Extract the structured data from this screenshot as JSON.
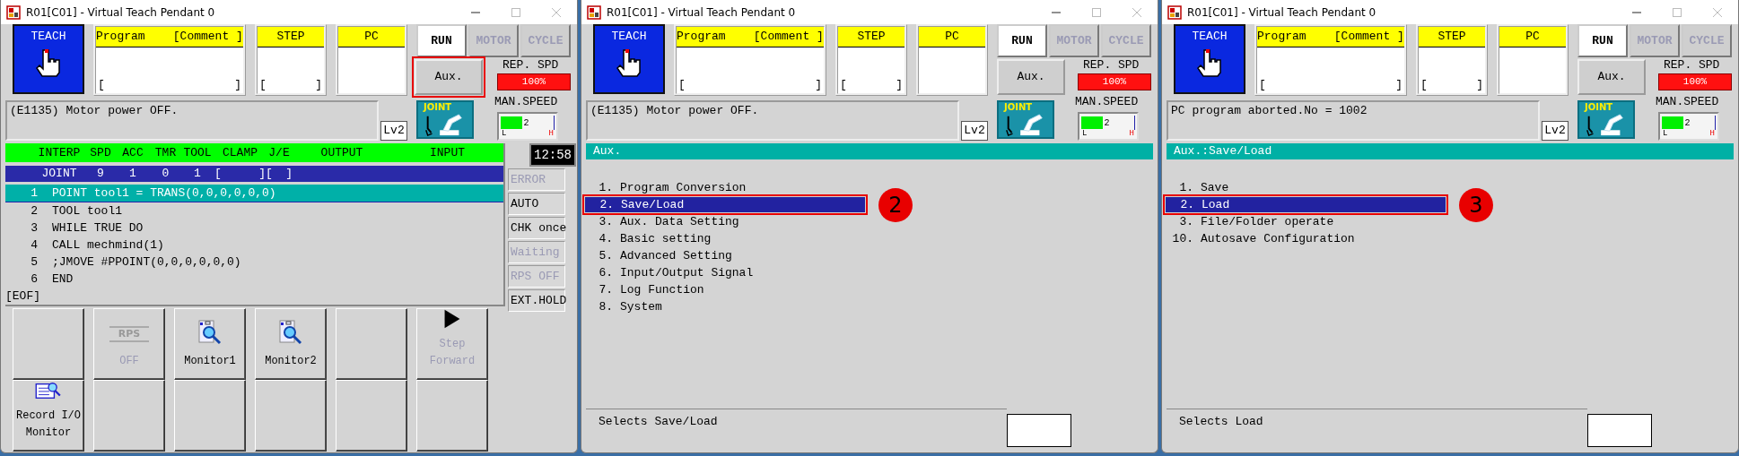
{
  "windows": [
    {
      "title": "R01[C01] - Virtual Teach Pendant 0",
      "mode": "TEACH",
      "program_box": {
        "label": "Program    [Comment ]",
        "bracket_open": "[",
        "bracket_close": "]"
      },
      "step_box": {
        "label": "STEP",
        "bracket_open": "[",
        "bracket_close": "]"
      },
      "pc_box": {
        "label": "PC"
      },
      "mode_buttons": [
        {
          "label": "RUN",
          "disabled": false
        },
        {
          "label": "MOTOR",
          "disabled": true
        },
        {
          "label": "CYCLE",
          "disabled": true
        }
      ],
      "aux_button": {
        "label": "Aux.",
        "highlighted": true
      },
      "rep_speed": {
        "label": "REP. SPD",
        "reading": "100%"
      },
      "man_speed": {
        "label": "MAN.SPEED",
        "level": 0.4,
        "reading": "2",
        "low": "L",
        "high": "H"
      },
      "message": "(E1135) Motor power OFF.",
      "access_level": "Lv2",
      "coordinate_mode": "JOINT",
      "screen": {
        "kind": "program",
        "clock": "12:58",
        "columns": [
          "INTERP",
          "SPD",
          "ACC",
          "TMR",
          "TOOL",
          "CLAMP",
          "J/E",
          "OUTPUT",
          "INPUT"
        ],
        "values": [
          "JOINT",
          "9",
          "1",
          "0",
          "1"
        ],
        "output": {
          "open": "[",
          "close": "]"
        },
        "input": {
          "open": "[",
          "close": "]"
        },
        "lines": [
          {
            "number": "1",
            "text": "POINT tool1 = TRANS(0,0,0,0,0,0)",
            "selected": true
          },
          {
            "number": "2",
            "text": "TOOL tool1",
            "selected": false
          },
          {
            "number": "3",
            "text": "WHILE TRUE DO",
            "selected": false
          },
          {
            "number": "4",
            "text": "CALL mechmind(1)",
            "selected": false
          },
          {
            "number": "5",
            "text": ";JMOVE #PPOINT(0,0,0,0,0,0)",
            "selected": false
          },
          {
            "number": "6",
            "text": "END",
            "selected": false
          }
        ],
        "eof": "[EOF]",
        "indicators": [
          {
            "label": "ERROR",
            "active": false
          },
          {
            "label": "AUTO",
            "active": true
          },
          {
            "label": "CHK once",
            "active": true
          },
          {
            "label": "Waiting",
            "active": false
          },
          {
            "label": "RPS OFF",
            "active": false
          },
          {
            "label": "EXT.HOLD",
            "active": true
          }
        ],
        "function_keys": [
          {
            "kind": "blank"
          },
          {
            "kind": "rps",
            "icon_label": "RPS",
            "label": "OFF",
            "disabled": true
          },
          {
            "kind": "monitor",
            "label": "Monitor1",
            "disabled": false
          },
          {
            "kind": "monitor",
            "label": "Monitor2",
            "disabled": false
          },
          {
            "kind": "blank"
          },
          {
            "kind": "step",
            "label": "Step Forward",
            "disabled": true
          },
          {
            "kind": "record",
            "label": "Record I/O Monitor",
            "disabled": false
          },
          {
            "kind": "blank"
          },
          {
            "kind": "blank"
          },
          {
            "kind": "blank"
          },
          {
            "kind": "blank"
          },
          {
            "kind": "blank"
          }
        ]
      }
    },
    {
      "title": "R01[C01] - Virtual Teach Pendant 0",
      "mode": "TEACH",
      "program_box": {
        "label": "Program    [Comment ]",
        "bracket_open": "[",
        "bracket_close": "]"
      },
      "step_box": {
        "label": "STEP",
        "bracket_open": "[",
        "bracket_close": "]"
      },
      "pc_box": {
        "label": "PC"
      },
      "mode_buttons": [
        {
          "label": "RUN",
          "disabled": false
        },
        {
          "label": "MOTOR",
          "disabled": true
        },
        {
          "label": "CYCLE",
          "disabled": true
        }
      ],
      "aux_button": {
        "label": "Aux.",
        "highlighted": false
      },
      "rep_speed": {
        "label": "REP. SPD",
        "reading": "100%"
      },
      "man_speed": {
        "label": "MAN.SPEED",
        "level": 0.4,
        "reading": "2",
        "low": "L",
        "high": "H"
      },
      "message": "(E1135) Motor power OFF.",
      "access_level": "Lv2",
      "coordinate_mode": "JOINT",
      "screen": {
        "kind": "menu",
        "title": "Aux.",
        "items": [
          {
            "number": "1.",
            "label": "Program Conversion",
            "selected": false
          },
          {
            "number": "2.",
            "label": "Save/Load",
            "selected": true,
            "callout": "2"
          },
          {
            "number": "3.",
            "label": "Aux. Data Setting",
            "selected": false
          },
          {
            "number": "4.",
            "label": "Basic setting",
            "selected": false
          },
          {
            "number": "5.",
            "label": "Advanced Setting",
            "selected": false
          },
          {
            "number": "6.",
            "label": "Input/Output Signal",
            "selected": false
          },
          {
            "number": "7.",
            "label": "Log Function",
            "selected": false
          },
          {
            "number": "8.",
            "label": "System",
            "selected": false
          }
        ],
        "hint": "Selects Save/Load"
      }
    },
    {
      "title": "R01[C01] - Virtual Teach Pendant 0",
      "mode": "TEACH",
      "program_box": {
        "label": "Program    [Comment ]",
        "bracket_open": "[",
        "bracket_close": "]"
      },
      "step_box": {
        "label": "STEP",
        "bracket_open": "[",
        "bracket_close": "]"
      },
      "pc_box": {
        "label": "PC"
      },
      "mode_buttons": [
        {
          "label": "RUN",
          "disabled": false
        },
        {
          "label": "MOTOR",
          "disabled": true
        },
        {
          "label": "CYCLE",
          "disabled": true
        }
      ],
      "aux_button": {
        "label": "Aux.",
        "highlighted": false
      },
      "rep_speed": {
        "label": "REP. SPD",
        "reading": "100%"
      },
      "man_speed": {
        "label": "MAN.SPEED",
        "level": 0.4,
        "reading": "2",
        "low": "L",
        "high": "H"
      },
      "message": "PC program aborted.No = 1002",
      "access_level": "Lv2",
      "coordinate_mode": "JOINT",
      "screen": {
        "kind": "menu",
        "title": "Aux.:Save/Load",
        "items": [
          {
            "number": "1.",
            "label": "Save",
            "selected": false
          },
          {
            "number": "2.",
            "label": "Load",
            "selected": true,
            "callout": "3"
          },
          {
            "number": "3.",
            "label": "File/Folder operate",
            "selected": false
          },
          {
            "number": "10.",
            "label": "Autosave Configuration",
            "selected": false
          }
        ],
        "hint": "Selects Load"
      }
    }
  ]
}
